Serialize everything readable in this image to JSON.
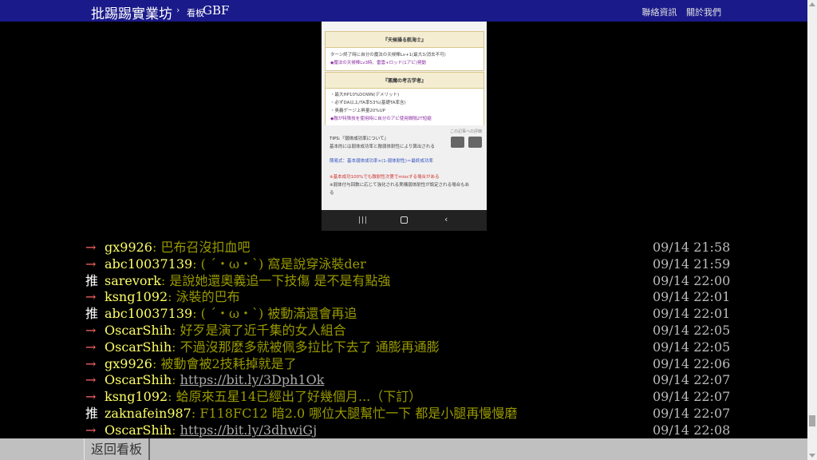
{
  "header": {
    "site_title": "批踢踢實業坊",
    "separator": "›",
    "board_prefix": "看板",
    "board_name": "GBF",
    "nav": [
      "聯絡資訊",
      "關於我們"
    ],
    "colors": {
      "bar": "#1a1a8a"
    }
  },
  "embedded_image": {
    "box1": {
      "title": "『天候操る航海士』",
      "lines": [
        "ターン終了時に自分の魔法の天候棒Lv+1(最大3/消去不可)",
        "◆魔法の天候棒Lv3時、雷雲+ロッド(1アビ)発動"
      ]
    },
    "box2": {
      "title": "『悪魔の考古学者』",
      "lines": [
        "・最大HP10%DOWN(デメリット)",
        "・必ずDA以上/TA率53%(基礎TA率含)",
        "・奥義ゲージ上昇量20%UP",
        "◆敵が特殊技を使用時に自分のアビ使用間隔2T短縮"
      ]
    },
    "eval_label": "この記事への評価",
    "tips_title": "TIPS:『弱体成功率について』",
    "tips_lines": [
      "基本的には弱体成功率と敵弱体耐性により算出される",
      "簡易式：基本弱体成功率×(1-弱体耐性)＝最終成功率",
      "※基本成功100%でも敵耐性次第でmissする場合がある",
      "※弱体付与回数に応じて強化される実構弱体耐性が設定される場合もあ",
      "る"
    ],
    "nav_buttons": {
      "recent": "|||",
      "back": "‹"
    }
  },
  "pushes": [
    {
      "tag": "→",
      "type": "arrow",
      "user": "gx9926",
      "content": ": 巴布召沒扣血吧",
      "time": "09/14 21:58"
    },
    {
      "tag": "→",
      "type": "arrow",
      "user": "abc10037139",
      "content": ": ( ´・ω・`) 窩是說穿泳裝der",
      "time": "09/14 21:59"
    },
    {
      "tag": "推",
      "type": "up",
      "user": "sarevork",
      "content": ": 是說她還奧義追一下技傷 是不是有點強",
      "time": "09/14 22:00"
    },
    {
      "tag": "→",
      "type": "arrow",
      "user": "ksng1092",
      "content": ": 泳裝的巴布",
      "time": "09/14 22:01"
    },
    {
      "tag": "推",
      "type": "up",
      "user": "abc10037139",
      "content": ": ( ´・ω・`) 被動滿還會再追",
      "time": "09/14 22:01"
    },
    {
      "tag": "→",
      "type": "arrow",
      "user": "OscarShih",
      "content": ": 好歹是演了近千集的女人組合",
      "time": "09/14 22:05"
    },
    {
      "tag": "→",
      "type": "arrow",
      "user": "OscarShih",
      "content": ": 不過沒那麼多就被佩多拉比下去了 通膨再通膨",
      "time": "09/14 22:05"
    },
    {
      "tag": "→",
      "type": "arrow",
      "user": "gx9926",
      "content": ": 被動會被2技耗掉就是了",
      "time": "09/14 22:06"
    },
    {
      "tag": "→",
      "type": "arrow",
      "user": "OscarShih",
      "content": ": ",
      "link": "https://bit.ly/3Dph1Ok",
      "time": "09/14 22:07"
    },
    {
      "tag": "→",
      "type": "arrow",
      "user": "ksng1092",
      "content": ": 蛤原來五星14已經出了好幾個月...（下訂）",
      "time": "09/14 22:07"
    },
    {
      "tag": "推",
      "type": "up",
      "user": "zaknafein987",
      "content": ": F118FC12 暗2.0 哪位大腿幫忙一下 都是小腿再慢慢磨",
      "time": "09/14 22:07"
    },
    {
      "tag": "→",
      "type": "arrow",
      "user": "OscarShih",
      "content": ": ",
      "link": "https://bit.ly/3dhwiGj",
      "time": "09/14 22:08"
    }
  ],
  "footer": {
    "back_label": "返回看板"
  }
}
